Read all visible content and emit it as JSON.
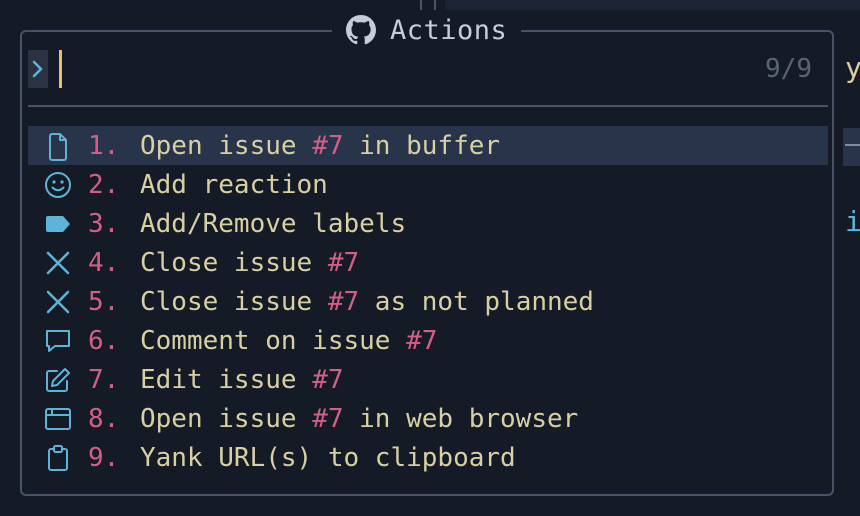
{
  "picker": {
    "title": "Actions",
    "title_icon": "github-icon",
    "prompt_icon": "chevron-right-icon",
    "query": "",
    "count": "9/9"
  },
  "background": {
    "char_y": "y",
    "char_i": "i"
  },
  "items": [
    {
      "num": "1.",
      "pre": "Open issue ",
      "ref": "#7",
      "post": " in buffer",
      "icon": "file-icon"
    },
    {
      "num": "2.",
      "pre": "Add reaction",
      "ref": "",
      "post": "",
      "icon": "smiley-icon"
    },
    {
      "num": "3.",
      "pre": "Add/Remove labels",
      "ref": "",
      "post": "",
      "icon": "tag-icon"
    },
    {
      "num": "4.",
      "pre": "Close issue ",
      "ref": "#7",
      "post": "",
      "icon": "x-icon"
    },
    {
      "num": "5.",
      "pre": "Close issue ",
      "ref": "#7",
      "post": " as not planned",
      "icon": "x-icon"
    },
    {
      "num": "6.",
      "pre": "Comment on issue ",
      "ref": "#7",
      "post": "",
      "icon": "comment-icon"
    },
    {
      "num": "7.",
      "pre": "Edit issue ",
      "ref": "#7",
      "post": "",
      "icon": "pencil-icon"
    },
    {
      "num": "8.",
      "pre": "Open issue ",
      "ref": "#7",
      "post": " in web browser",
      "icon": "browser-icon"
    },
    {
      "num": "9.",
      "pre": "Yank URL(s) to clipboard",
      "ref": "",
      "post": "",
      "icon": "clipboard-icon"
    }
  ],
  "selected_index": 0,
  "colors": {
    "accent_number": "#d45f85",
    "item_text": "#d8cfa3",
    "icon": "#5fb3d9",
    "selection": "#27344a",
    "border": "#4a5268"
  }
}
